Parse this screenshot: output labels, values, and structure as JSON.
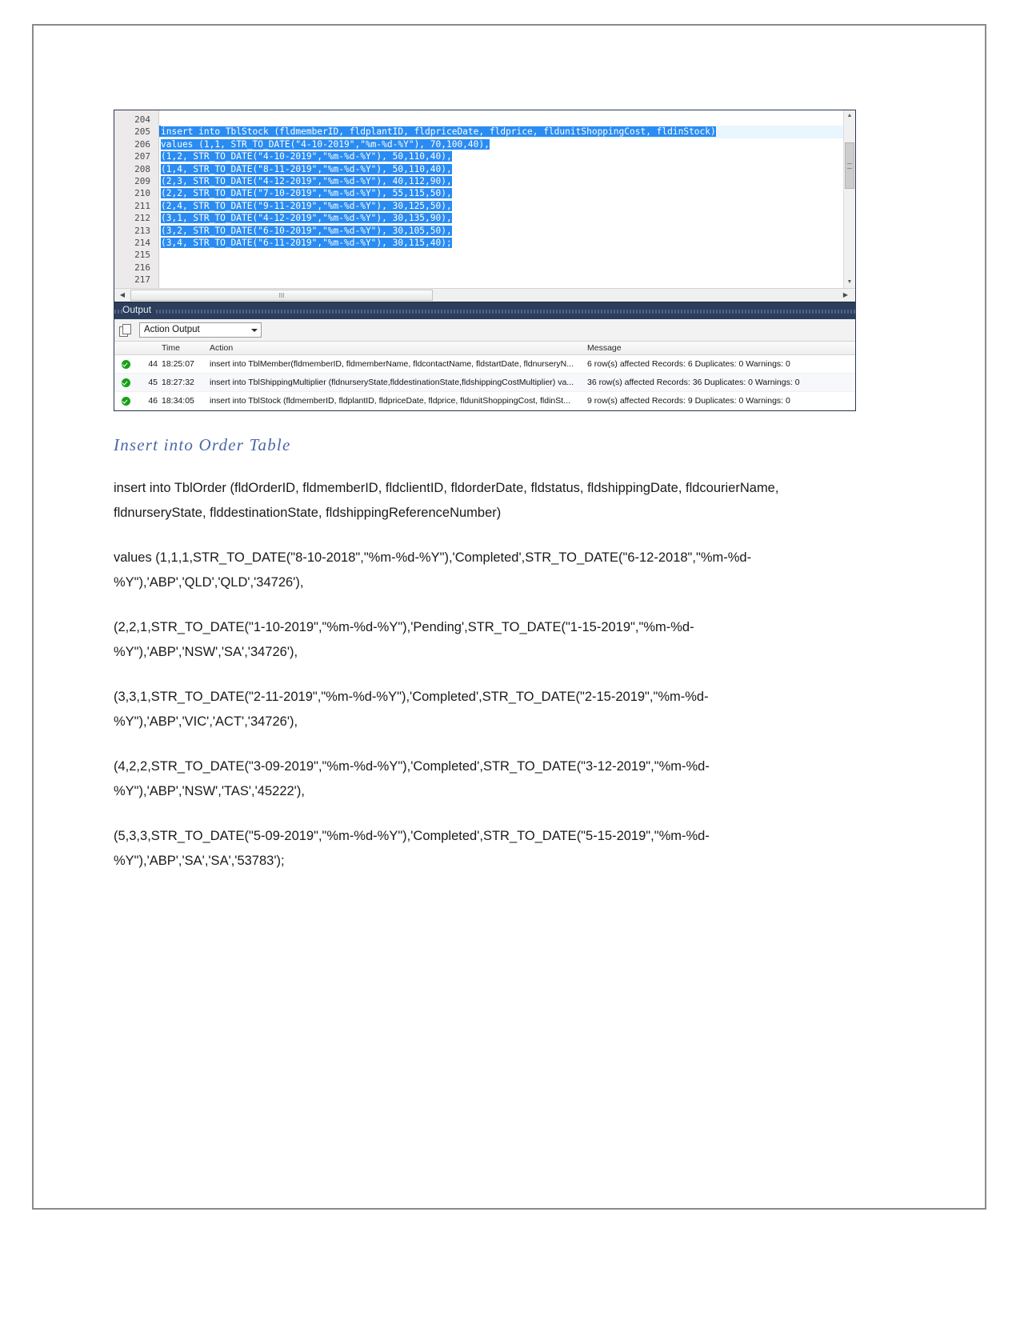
{
  "workbench": {
    "editor": {
      "lines": [
        {
          "num": "204",
          "text": "",
          "selected": false,
          "breakpoint": false
        },
        {
          "num": "205",
          "text": "insert into TblStock (fldmemberID, fldplantID, fldpriceDate, fldprice, fldunitShoppingCost, fldinStock)",
          "selected": true,
          "breakpoint": true
        },
        {
          "num": "206",
          "text": "values (1,1, STR_TO_DATE(\"4-10-2019\",\"%m-%d-%Y\"), 70,100,40),",
          "selected": true,
          "breakpoint": false
        },
        {
          "num": "207",
          "text": "(1,2, STR_TO_DATE(\"4-10-2019\",\"%m-%d-%Y\"), 50,110,40),",
          "selected": true,
          "breakpoint": false
        },
        {
          "num": "208",
          "text": "(1,4, STR_TO_DATE(\"8-11-2019\",\"%m-%d-%Y\"), 50,110,40),",
          "selected": true,
          "breakpoint": false
        },
        {
          "num": "209",
          "text": "(2,3, STR_TO_DATE(\"4-12-2019\",\"%m-%d-%Y\"), 40,112,90),",
          "selected": true,
          "breakpoint": false
        },
        {
          "num": "210",
          "text": "(2,2, STR_TO_DATE(\"7-10-2019\",\"%m-%d-%Y\"), 55,115,50),",
          "selected": true,
          "breakpoint": false
        },
        {
          "num": "211",
          "text": "(2,4, STR_TO_DATE(\"9-11-2019\",\"%m-%d-%Y\"), 30,125,50),",
          "selected": true,
          "breakpoint": false
        },
        {
          "num": "212",
          "text": "(3,1, STR_TO_DATE(\"4-12-2019\",\"%m-%d-%Y\"), 30,135,90),",
          "selected": true,
          "breakpoint": false
        },
        {
          "num": "213",
          "text": "(3,2, STR_TO_DATE(\"6-10-2019\",\"%m-%d-%Y\"), 30,105,50),",
          "selected": true,
          "breakpoint": false
        },
        {
          "num": "214",
          "text": "(3,4, STR_TO_DATE(\"6-11-2019\",\"%m-%d-%Y\"), 30,115,40);",
          "selected": true,
          "breakpoint": false
        },
        {
          "num": "215",
          "text": "",
          "selected": false,
          "breakpoint": false
        },
        {
          "num": "216",
          "text": "",
          "selected": false,
          "breakpoint": false
        },
        {
          "num": "217",
          "text": "",
          "selected": false,
          "breakpoint": false
        }
      ],
      "h_scroll_grip": "III",
      "left_arrow": "◀",
      "right_arrow": "▶",
      "up_arrow": "▲",
      "down_arrow": "▼",
      "thumb_grip": "≡"
    },
    "output_panel": {
      "title": "Output",
      "selector_value": "Action Output",
      "columns": [
        "",
        "",
        "Time",
        "Action",
        "Message"
      ],
      "rows": [
        {
          "status": "success",
          "index": "44",
          "time": "18:25:07",
          "action": "insert into TblMember(fldmemberID, fldmemberName, fldcontactName, fldstartDate, fldnurseryN...",
          "message": "6 row(s) affected Records: 6  Duplicates: 0  Warnings: 0"
        },
        {
          "status": "success",
          "index": "45",
          "time": "18:27:32",
          "action": "insert into TblShippingMultiplier (fldnurseryState,flddestinationState,fldshippingCostMultiplier) va...",
          "message": "36 row(s) affected Records: 36  Duplicates: 0  Warnings: 0"
        },
        {
          "status": "success",
          "index": "46",
          "time": "18:34:05",
          "action": "insert into TblStock (fldmemberID, fldplantID, fldpriceDate, fldprice, fldunitShoppingCost, fldinSt...",
          "message": "9 row(s) affected Records: 9  Duplicates: 0  Warnings: 0"
        }
      ]
    }
  },
  "document": {
    "heading": "Insert into Order Table",
    "paragraphs": [
      "insert into TblOrder (fldOrderID, fldmemberID, fldclientID, fldorderDate, fldstatus, fldshippingDate, fldcourierName, fldnurseryState, flddestinationState, fldshippingReferenceNumber)",
      "values (1,1,1,STR_TO_DATE(\"8-10-2018\",\"%m-%d-%Y\"),'Completed',STR_TO_DATE(\"6-12-2018\",\"%m-%d-%Y\"),'ABP','QLD','QLD','34726'),",
      "(2,2,1,STR_TO_DATE(\"1-10-2019\",\"%m-%d-%Y\"),'Pending',STR_TO_DATE(\"1-15-2019\",\"%m-%d-%Y\"),'ABP','NSW','SA','34726'),",
      "(3,3,1,STR_TO_DATE(\"2-11-2019\",\"%m-%d-%Y\"),'Completed',STR_TO_DATE(\"2-15-2019\",\"%m-%d-%Y\"),'ABP','VIC','ACT','34726'),",
      "(4,2,2,STR_TO_DATE(\"3-09-2019\",\"%m-%d-%Y\"),'Completed',STR_TO_DATE(\"3-12-2019\",\"%m-%d-%Y\"),'ABP','NSW','TAS','45222'),",
      "(5,3,3,STR_TO_DATE(\"5-09-2019\",\"%m-%d-%Y\"),'Completed',STR_TO_DATE(\"5-15-2019\",\"%m-%d-%Y\"),'ABP','SA','SA','53783');"
    ]
  },
  "colors": {
    "selection_blue": "#2a8cf2",
    "output_titlebar": "#2c3e5c",
    "heading_blue": "#4a68a8",
    "success_green": "#18a017"
  }
}
